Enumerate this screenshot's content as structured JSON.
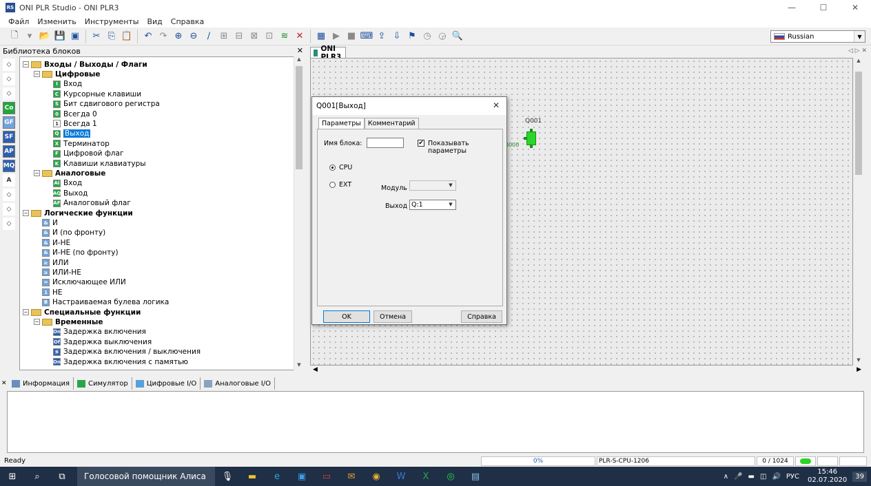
{
  "window": {
    "title": "ONI PLR Studio - ONI PLR3",
    "app_icon": "RS"
  },
  "menu": [
    "Файл",
    "Изменить",
    "Инструменты",
    "Вид",
    "Справка"
  ],
  "language": {
    "selected": "Russian"
  },
  "library": {
    "title": "Библиотека блоков",
    "tree": [
      {
        "label": "Входы / Выходы / Флаги",
        "level": 0,
        "bold": true,
        "folder": true,
        "toggle": "−"
      },
      {
        "label": "Цифровые",
        "level": 1,
        "bold": true,
        "folder": true,
        "toggle": "−"
      },
      {
        "label": "Вход",
        "level": 2,
        "icon": "I",
        "color": "#2aa64a"
      },
      {
        "label": "Курсорные клавиши",
        "level": 2,
        "icon": "C",
        "color": "#2aa64a"
      },
      {
        "label": "Бит сдвигового регистра",
        "level": 2,
        "icon": "S",
        "color": "#2aa64a"
      },
      {
        "label": "Всегда 0",
        "level": 2,
        "icon": "0",
        "color": "#2aa64a"
      },
      {
        "label": "Всегда 1",
        "level": 2,
        "icon": "1",
        "color": "#ffffff"
      },
      {
        "label": "Выход",
        "level": 2,
        "icon": "Q",
        "color": "#2aa64a",
        "selected": true
      },
      {
        "label": "Терминатор",
        "level": 2,
        "icon": "X",
        "color": "#2aa64a"
      },
      {
        "label": "Цифровой флаг",
        "level": 2,
        "icon": "F",
        "color": "#2aa64a"
      },
      {
        "label": "Клавиши клавиатуры",
        "level": 2,
        "icon": "K",
        "color": "#2aa64a"
      },
      {
        "label": "Аналоговые",
        "level": 1,
        "bold": true,
        "folder": true,
        "toggle": "−"
      },
      {
        "label": "Вход",
        "level": 2,
        "icon": "AI",
        "color": "#2aa64a"
      },
      {
        "label": "Выход",
        "level": 2,
        "icon": "AQ",
        "color": "#2aa64a"
      },
      {
        "label": "Аналоговый флаг",
        "level": 2,
        "icon": "AF",
        "color": "#2aa64a"
      },
      {
        "label": "Логические функции",
        "level": 0,
        "bold": true,
        "folder": true,
        "toggle": "−"
      },
      {
        "label": "И",
        "level": 1,
        "icon": "&",
        "color": "#6fa3dd"
      },
      {
        "label": "И (по фронту)",
        "level": 1,
        "icon": "&",
        "color": "#6fa3dd"
      },
      {
        "label": "И-НЕ",
        "level": 1,
        "icon": "&",
        "color": "#6fa3dd"
      },
      {
        "label": "И-НЕ (по фронту)",
        "level": 1,
        "icon": "&",
        "color": "#6fa3dd"
      },
      {
        "label": "ИЛИ",
        "level": 1,
        "icon": "≥",
        "color": "#6fa3dd"
      },
      {
        "label": "ИЛИ-НЕ",
        "level": 1,
        "icon": "≥",
        "color": "#6fa3dd"
      },
      {
        "label": "Исключающее ИЛИ",
        "level": 1,
        "icon": "=",
        "color": "#6fa3dd"
      },
      {
        "label": "НЕ",
        "level": 1,
        "icon": "1",
        "color": "#6fa3dd"
      },
      {
        "label": "Настраиваемая булева логика",
        "level": 1,
        "icon": "B",
        "color": "#6fa3dd"
      },
      {
        "label": "Специальные функции",
        "level": 0,
        "bold": true,
        "folder": true,
        "toggle": "−"
      },
      {
        "label": "Временные",
        "level": 1,
        "bold": true,
        "folder": true,
        "toggle": "−"
      },
      {
        "label": "Задержка включения",
        "level": 2,
        "icon": "On",
        "color": "#2d5fae"
      },
      {
        "label": "Задержка выключения",
        "level": 2,
        "icon": "Of",
        "color": "#2d5fae"
      },
      {
        "label": "Задержка включения / выключения",
        "level": 2,
        "icon": "≶",
        "color": "#2d5fae"
      },
      {
        "label": "Задержка включения с памятью",
        "level": 2,
        "icon": "On",
        "color": "#2d5fae"
      }
    ]
  },
  "side_icons": [
    {
      "label": "",
      "color": "#ffffff"
    },
    {
      "label": "",
      "color": "#ffffff"
    },
    {
      "label": "",
      "color": "#ffffff"
    },
    {
      "label": "Co",
      "color": "#1fa83a"
    },
    {
      "label": "GF",
      "color": "#6fa3dd"
    },
    {
      "label": "SF",
      "color": "#2d5fae"
    },
    {
      "label": "AP",
      "color": "#2d5fae"
    },
    {
      "label": "MQ",
      "color": "#2d5fae"
    },
    {
      "label": "A",
      "color": "#ffffff"
    },
    {
      "label": "",
      "color": "#ffffff"
    },
    {
      "label": "",
      "color": "#ffffff"
    },
    {
      "label": "",
      "color": "#ffffff"
    }
  ],
  "document": {
    "tab_label": "ONI PLR3"
  },
  "canvas_block": {
    "label": "Q001",
    "input_text": "0000"
  },
  "dialog": {
    "title": "Q001[Выход]",
    "tabs": [
      "Параметры",
      "Комментарий"
    ],
    "block_name_label": "Имя блока:",
    "block_name_value": "",
    "show_params_label": "Показывать параметры",
    "show_params_checked": true,
    "radio_cpu": "CPU",
    "radio_ext": "EXT",
    "module_label": "Модуль",
    "module_value": "",
    "output_label": "Выход",
    "output_value": "Q:1",
    "ok": "OK",
    "cancel": "Отмена",
    "help": "Справка"
  },
  "info_tabs": [
    "Информация",
    "Симулятор",
    "Цифровые I/O",
    "Аналоговые I/O"
  ],
  "status": {
    "ready": "Ready",
    "progress": "0%",
    "model": "PLR-S-CPU-1206",
    "counter": "0 / 1024"
  },
  "taskbar": {
    "search_text": "Голосовой помощник Алиса",
    "lang": "РУС",
    "time": "15:46",
    "date": "02.07.2020",
    "notification_count": "39"
  }
}
